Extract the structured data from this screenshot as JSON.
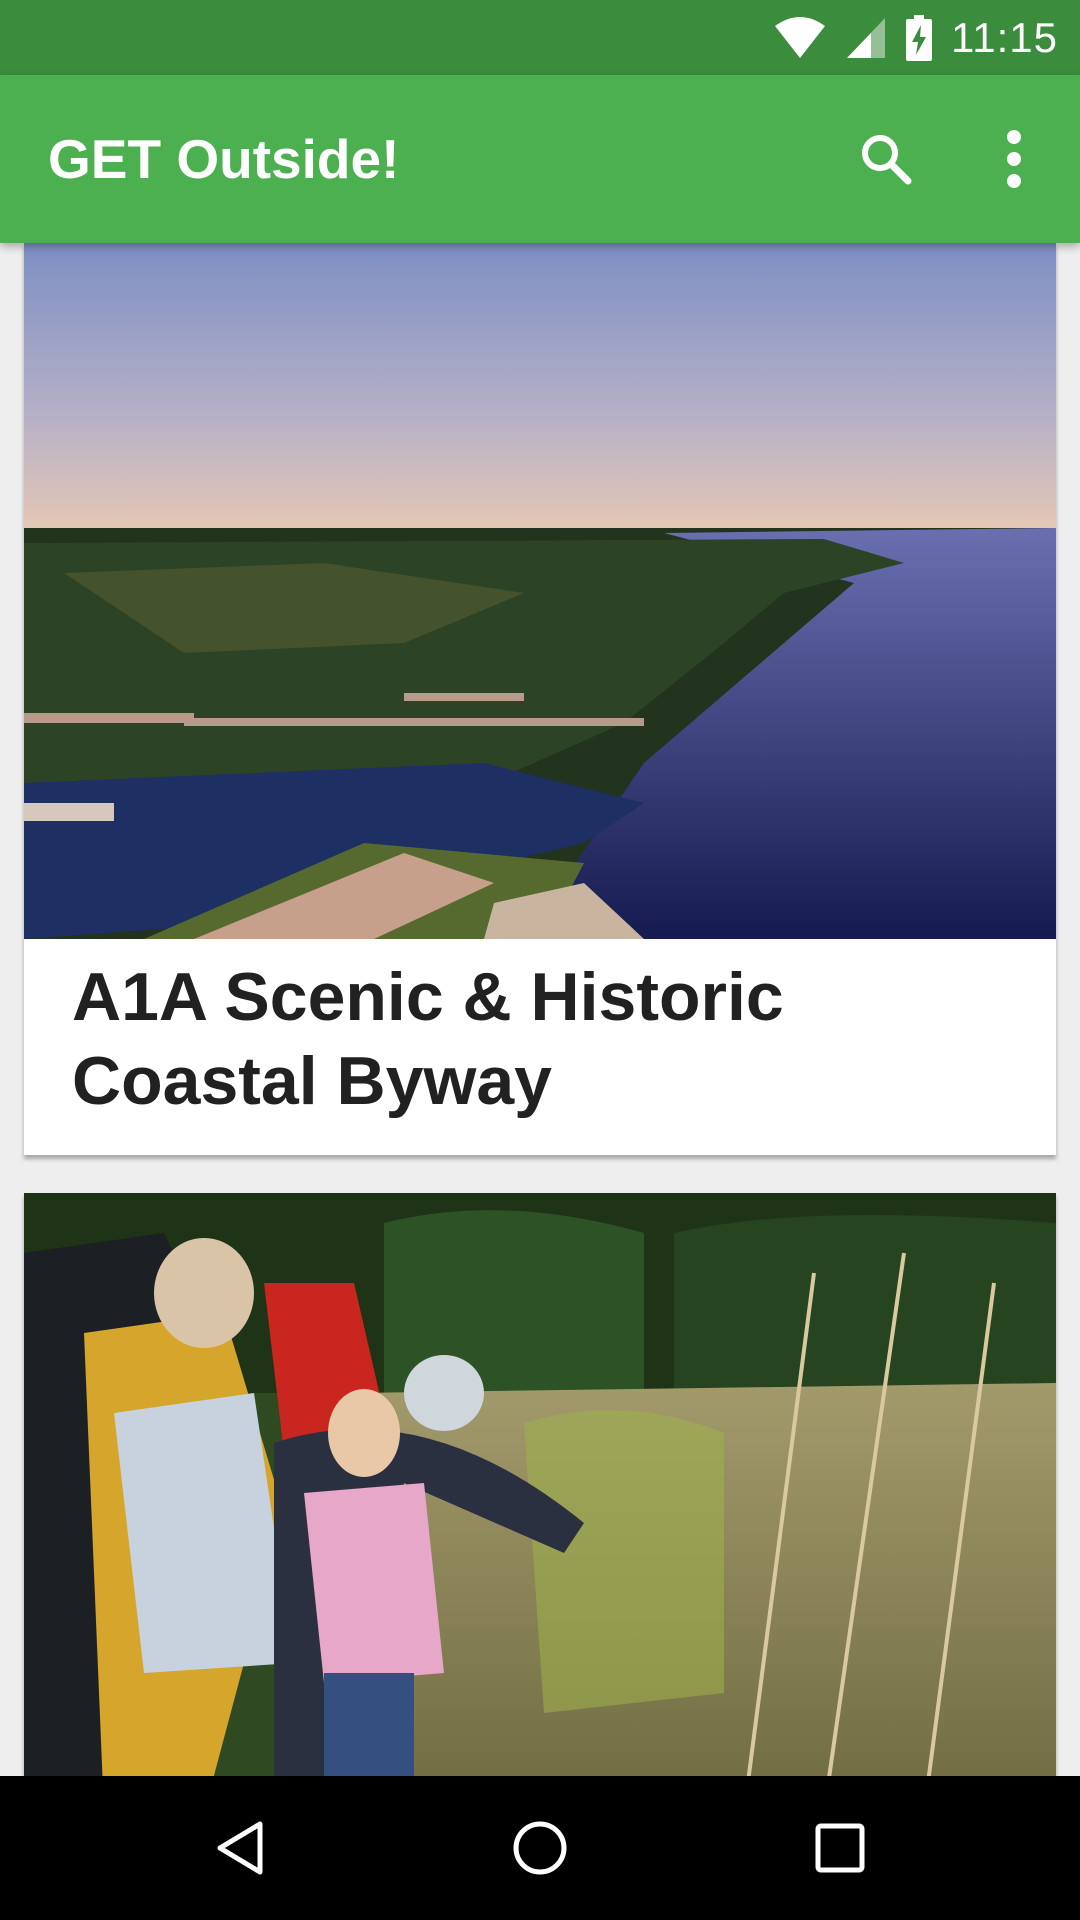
{
  "status_bar": {
    "time": "11:15",
    "icons": [
      "wifi-icon",
      "cell-signal-icon",
      "battery-charging-icon"
    ]
  },
  "app_bar": {
    "title": "GET Outside!",
    "actions": [
      "search-icon",
      "more-vert-icon"
    ]
  },
  "cards": [
    {
      "title": "A1A Scenic & Historic Coastal Byway",
      "image": "aerial view of a coastal river, marsh and boardwalk at dusk"
    },
    {
      "title": "",
      "image": "group of people on a nature walk pointing at tall grasses"
    }
  ],
  "nav_bar": {
    "buttons": [
      "back-icon",
      "home-icon",
      "recents-icon"
    ]
  },
  "colors": {
    "status_bar": "#3b8c3d",
    "app_bar": "#4caf50",
    "background": "#eeeeee",
    "nav_bar": "#000000",
    "title_text": "#212121"
  }
}
